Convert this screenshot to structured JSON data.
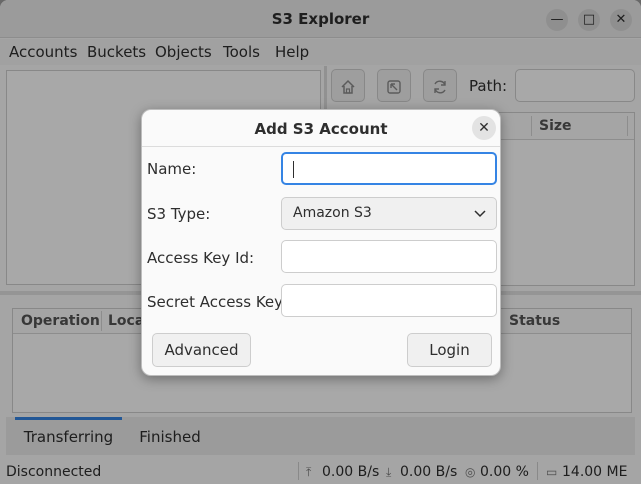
{
  "window": {
    "title": "S3 Explorer",
    "minimize_glyph": "—",
    "maximize_glyph": "□",
    "close_glyph": "✕"
  },
  "menubar": {
    "items": [
      "Accounts",
      "Buckets",
      "Objects",
      "Tools",
      "Help"
    ]
  },
  "toolbar": {
    "home_icon": "home-icon",
    "up_icon": "folder-up-icon",
    "refresh_icon": "refresh-icon",
    "path_label": "Path:",
    "path_value": ""
  },
  "file_list": {
    "columns": [
      "Size"
    ]
  },
  "transfers": {
    "columns": [
      "Operation",
      "Local",
      "Status"
    ],
    "tabs": [
      {
        "label": "Transferring",
        "active": true
      },
      {
        "label": "Finished",
        "active": false
      }
    ]
  },
  "statusbar": {
    "connection": "Disconnected",
    "upload_speed": "0.00 B/s",
    "download_speed": "0.00 B/s",
    "progress": "0.00 %",
    "memory": "14.00 ME"
  },
  "dialog": {
    "title": "Add S3 Account",
    "fields": {
      "name_label": "Name:",
      "name_value": "",
      "s3type_label": "S3 Type:",
      "s3type_value": "Amazon S3",
      "access_key_label": "Access Key Id:",
      "access_key_value": "",
      "secret_key_label": "Secret Access Key:",
      "secret_key_value": ""
    },
    "advanced_button": "Advanced",
    "login_button": "Login"
  },
  "colors": {
    "accent": "#3584e4"
  }
}
